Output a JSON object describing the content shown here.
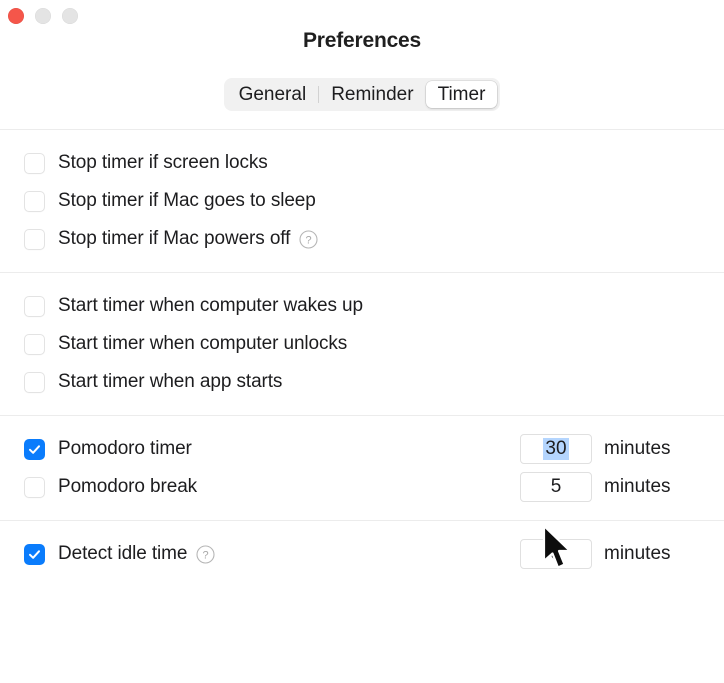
{
  "window": {
    "title": "Preferences",
    "traffic_lights": [
      {
        "name": "close",
        "color": "#f5564a"
      },
      {
        "name": "minimize",
        "color": "#e4e4e4"
      },
      {
        "name": "maximize",
        "color": "#e4e4e4"
      }
    ]
  },
  "tabs": {
    "items": [
      {
        "label": "General",
        "selected": false
      },
      {
        "label": "Reminder",
        "selected": false
      },
      {
        "label": "Timer",
        "selected": true
      }
    ]
  },
  "sections": [
    {
      "name": "stop-timer",
      "rows": [
        {
          "label": "Stop timer if screen locks",
          "checked": false,
          "help": false
        },
        {
          "label": "Stop timer if Mac goes to sleep",
          "checked": false,
          "help": false
        },
        {
          "label": "Stop timer if Mac powers off",
          "checked": false,
          "help": true
        }
      ]
    },
    {
      "name": "start-timer",
      "rows": [
        {
          "label": "Start timer when computer wakes up",
          "checked": false,
          "help": false
        },
        {
          "label": "Start timer when computer unlocks",
          "checked": false,
          "help": false
        },
        {
          "label": "Start timer when app starts",
          "checked": false,
          "help": false
        }
      ]
    },
    {
      "name": "pomodoro",
      "rows": [
        {
          "label": "Pomodoro timer",
          "checked": true,
          "help": false,
          "value": "30",
          "units": "minutes",
          "focused": true
        },
        {
          "label": "Pomodoro break",
          "checked": false,
          "help": false,
          "value": "5",
          "units": "minutes",
          "focused": false
        }
      ]
    },
    {
      "name": "idle",
      "rows": [
        {
          "label": "Detect idle time",
          "checked": true,
          "help": true,
          "value": "5",
          "units": "minutes",
          "focused": false
        }
      ]
    }
  ],
  "icons": {
    "help": "help-circle-icon",
    "checkmark": "checkmark-icon",
    "cursor": "mouse-arrow-cursor"
  },
  "colors": {
    "accent": "#0a7cfc",
    "selection": "#b4d5fe",
    "close": "#f5564a",
    "divider": "#ececec"
  }
}
